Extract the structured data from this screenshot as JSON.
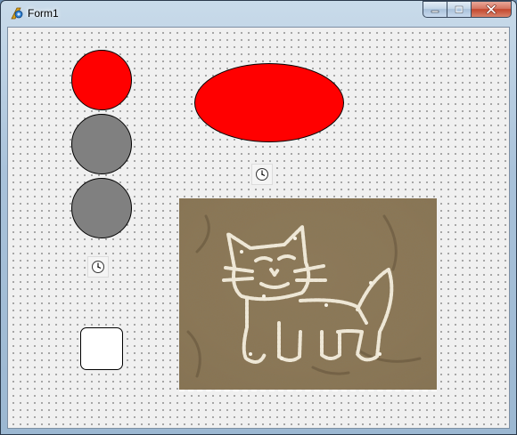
{
  "window": {
    "title": "Form1"
  },
  "caption_buttons": {
    "minimize": "—",
    "maximize": "□",
    "close": "✕"
  },
  "colors": {
    "shape_red": "#ff0000",
    "shape_gray": "#808080",
    "shape_white": "#ffffff",
    "sand": "#9a8564"
  },
  "icons": {
    "app": "delphi-app-icon",
    "timer": "clock-icon"
  },
  "form": {
    "shapes": [
      {
        "name": "red-circle",
        "fill": "#ff0000"
      },
      {
        "name": "gray-circle-1",
        "fill": "#808080"
      },
      {
        "name": "gray-circle-2",
        "fill": "#808080"
      },
      {
        "name": "red-ellipse",
        "fill": "#ff0000"
      },
      {
        "name": "white-rounded-rectangle",
        "fill": "#ffffff"
      }
    ],
    "timers": 2,
    "image": "sand-cat-drawing"
  }
}
